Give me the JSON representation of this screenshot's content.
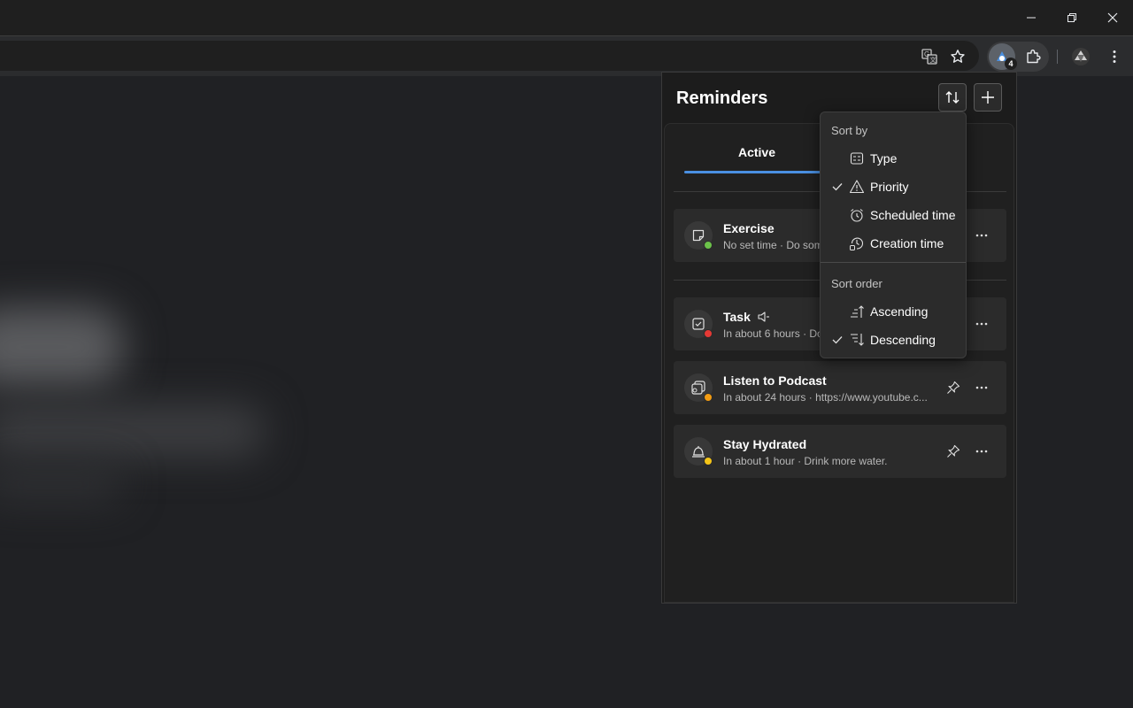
{
  "window": {
    "minimize_icon": "minimize-icon",
    "restore_icon": "restore-icon",
    "close_icon": "close-icon"
  },
  "toolbar": {
    "icons": [
      "translate-icon",
      "star-icon",
      "reminders-extension-icon",
      "puzzle-icon",
      "profile-icon",
      "kebab-menu-icon"
    ],
    "extension_badge": "4"
  },
  "popup": {
    "title": "Reminders",
    "sort_button_icon": "sort-icon",
    "add_button_icon": "plus-icon",
    "tabs": [
      {
        "label": "Active",
        "selected": true
      }
    ],
    "accent": "#4a90e2",
    "reminders": [
      {
        "title": "Exercise",
        "subtitle": "No set time · Do som",
        "icon": "sticky-note-icon",
        "status_color": "#6cc24a",
        "pinned_icon": false
      },
      {
        "title": "Task",
        "subtitle": "In about 6 hours · Do",
        "icon": "checkbox-icon",
        "status_color": "#e53935",
        "has_sound_icon": true
      },
      {
        "title": "Listen to Podcast",
        "subtitle": "In about 24 hours · https://www.youtube.c...",
        "icon": "web-link-icon",
        "status_color": "#f39c12",
        "pinned_icon": true
      },
      {
        "title": "Stay Hydrated",
        "subtitle": "In about 1 hour · Drink more water.",
        "icon": "bell-icon",
        "status_color": "#f5c518",
        "pinned_icon": true
      }
    ]
  },
  "sort_menu": {
    "sort_by_heading": "Sort by",
    "sort_by": [
      {
        "label": "Type",
        "icon": "type-icon",
        "checked": false
      },
      {
        "label": "Priority",
        "icon": "warning-icon",
        "checked": true
      },
      {
        "label": "Scheduled time",
        "icon": "alarm-icon",
        "checked": false
      },
      {
        "label": "Creation time",
        "icon": "history-icon",
        "checked": false
      }
    ],
    "sort_order_heading": "Sort order",
    "sort_order": [
      {
        "label": "Ascending",
        "icon": "ascending-icon",
        "checked": false
      },
      {
        "label": "Descending",
        "icon": "descending-icon",
        "checked": true
      }
    ]
  }
}
